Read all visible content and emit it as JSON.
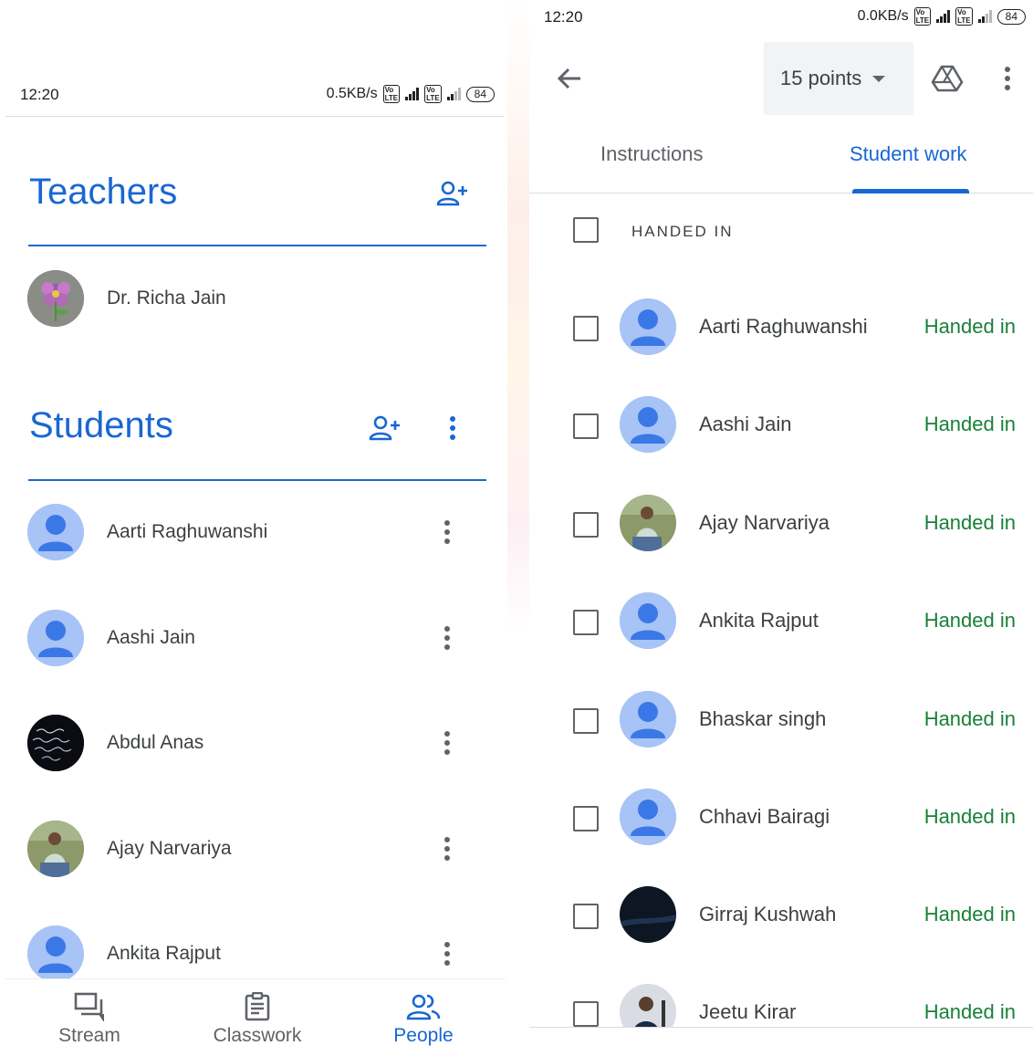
{
  "left": {
    "status_bar": {
      "time": "12:20",
      "speed": "0.5KB/s",
      "volte1": "Vo LTE",
      "volte2": "Vo LTE",
      "net_4g": "4G",
      "battery": "84"
    },
    "teachers": {
      "title": "Teachers",
      "add_icon": "add-person-icon",
      "items": [
        {
          "name": "Dr. Richa Jain",
          "avatar": "flower-drawing-photo"
        }
      ]
    },
    "students": {
      "title": "Students",
      "add_icon": "add-person-icon",
      "menu_icon": "more-vert-icon",
      "items": [
        {
          "name": "Aarti Raghuwanshi",
          "avatar": "default-person"
        },
        {
          "name": "Aashi Jain",
          "avatar": "default-person"
        },
        {
          "name": "Abdul Anas",
          "avatar": "chalkboard-photo"
        },
        {
          "name": "Ajay Narvariya",
          "avatar": "outdoor-photo"
        },
        {
          "name": "Ankita Rajput",
          "avatar": "default-person"
        }
      ]
    },
    "bottom_nav": {
      "items": [
        {
          "label": "Stream",
          "icon": "stream-icon",
          "active": false
        },
        {
          "label": "Classwork",
          "icon": "classwork-icon",
          "active": false
        },
        {
          "label": "People",
          "icon": "people-icon",
          "active": true
        }
      ]
    }
  },
  "right": {
    "status_bar": {
      "time": "12:20",
      "speed": "0.0KB/s",
      "volte1": "Vo LTE",
      "volte2": "Vo LTE",
      "net_4g": "4G",
      "battery": "84"
    },
    "toolbar": {
      "back_icon": "arrow-back-icon",
      "points": "15 points",
      "drive_icon": "google-drive-icon",
      "menu_icon": "more-vert-icon"
    },
    "tabs": [
      {
        "label": "Instructions",
        "active": false
      },
      {
        "label": "Student work",
        "active": true
      }
    ],
    "group_header": "HANDED IN",
    "rows": [
      {
        "name": "Aarti Raghuwanshi",
        "status": "Handed in",
        "avatar": "default-person"
      },
      {
        "name": "Aashi Jain",
        "status": "Handed in",
        "avatar": "default-person"
      },
      {
        "name": "Ajay Narvariya",
        "status": "Handed in",
        "avatar": "outdoor-photo"
      },
      {
        "name": "Ankita Rajput",
        "status": "Handed in",
        "avatar": "default-person"
      },
      {
        "name": "Bhaskar singh",
        "status": "Handed in",
        "avatar": "default-person"
      },
      {
        "name": "Chhavi Bairagi",
        "status": "Handed in",
        "avatar": "default-person"
      },
      {
        "name": "Girraj Kushwah",
        "status": "Handed in",
        "avatar": "dark-photo"
      },
      {
        "name": "Jeetu Kirar",
        "status": "Handed in",
        "avatar": "portrait-photo"
      }
    ]
  },
  "colors": {
    "accent": "#1967d2",
    "handed_in": "#188038",
    "avatar_bg": "#c6d7f8",
    "avatar_fg": "#4285f4"
  }
}
